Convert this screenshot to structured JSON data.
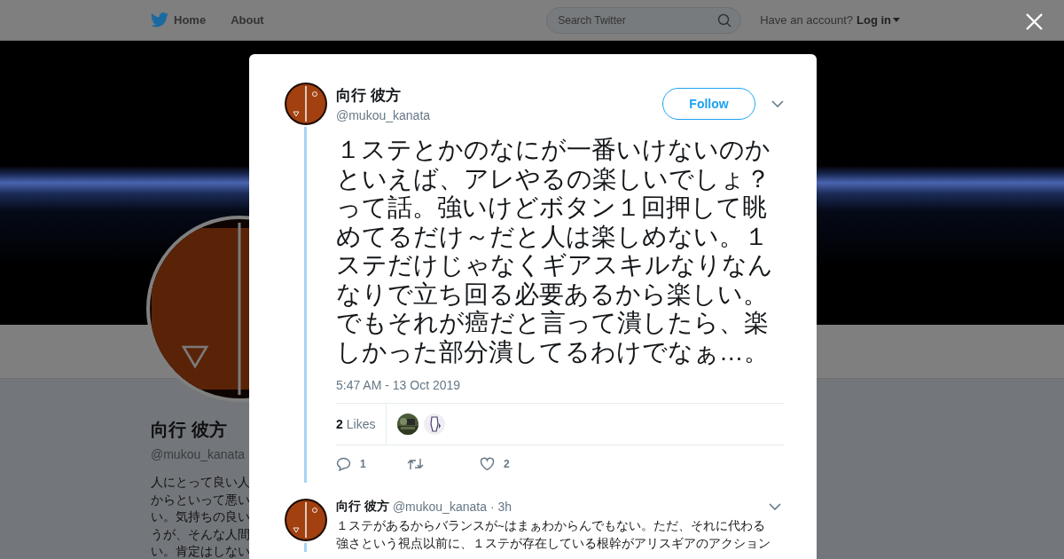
{
  "header": {
    "nav": [
      {
        "label": "Home",
        "kind": "home"
      },
      {
        "label": "About",
        "kind": "plain"
      }
    ],
    "search": {
      "placeholder": "Search Twitter"
    },
    "account_prompt": "Have an account?",
    "login": "Log in"
  },
  "profile": {
    "name": "向行 彼方",
    "handle": "@mukou_kanata",
    "bio_lines": [
      "人にとって良い人",
      "からといって悪い",
      "い。気持ちの良い",
      "うが、そんな人間",
      "い。肯定はしない"
    ]
  },
  "tweet": {
    "name": "向行 彼方",
    "handle": "@mukou_kanata",
    "follow": "Follow",
    "text": "１ステとかのなにが一番いけないのかといえば、アレやるの楽しいでしょ？って話。強いけどボタン１回押して眺めてるだけ～だと人は楽しめない。１ステだけじゃなくギアスキルなりなんなりで立ち回る必要あるから楽しい。でもそれが癌だと言って潰したら、楽しかった部分潰してるわけでなぁ…。",
    "timestamp": "5:47 AM - 13 Oct 2019",
    "likes_count": "2",
    "likes_label": "Likes",
    "likers": [
      {
        "kind": "picture"
      },
      {
        "kind": "figure"
      }
    ],
    "actions": [
      {
        "kind": "reply",
        "count": "1"
      },
      {
        "kind": "retweet"
      },
      {
        "kind": "like",
        "count": "2"
      }
    ]
  },
  "replies": [
    {
      "name": "向行 彼方",
      "handle": "@mukou_kanata",
      "time": "· 3h",
      "text_lines": [
        "１ステがあるからバランスが~はまぁわからんでもない。ただ、それに代わる",
        "強さという視点以前に、１ステが存在している根幹がアリスギアのアクション"
      ]
    }
  ]
}
